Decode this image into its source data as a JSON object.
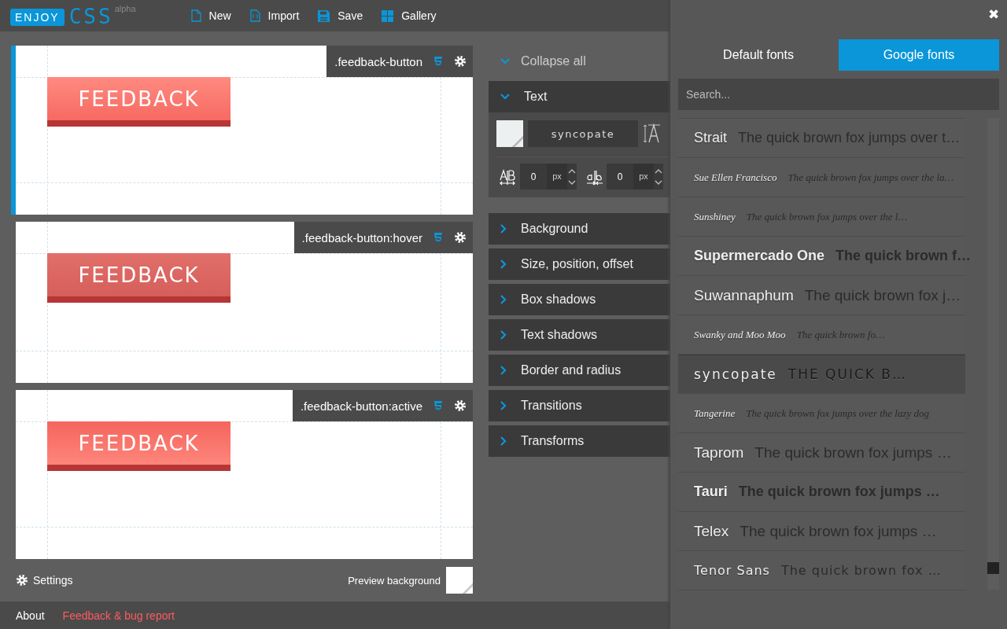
{
  "logo": {
    "word": "ENJOY",
    "name": "CSS",
    "tag": "alpha"
  },
  "toolbar": [
    {
      "label": "New",
      "kind": "file"
    },
    {
      "label": "Import",
      "kind": "import"
    },
    {
      "label": "Save",
      "kind": "save"
    },
    {
      "label": "Gallery",
      "kind": "gallery"
    }
  ],
  "previews": [
    {
      "selector": ".feedback-button",
      "selected": true,
      "kind": "normal",
      "button_text": "FEEDBACK"
    },
    {
      "selector": ".feedback-button:hover",
      "selected": false,
      "kind": "hover",
      "button_text": "FEEDBACK"
    },
    {
      "selector": ".feedback-button:active",
      "selected": false,
      "kind": "active",
      "button_text": "FEEDBACK"
    }
  ],
  "settings": {
    "label": "Settings"
  },
  "preview_background": {
    "label": "Preview background"
  },
  "properties": {
    "collapse_all": "Collapse all",
    "text_controls": {
      "font": "syncopate",
      "letter_spacing": {
        "value": "0",
        "unit": "px"
      },
      "word_spacing": {
        "value": "0",
        "unit": "px"
      }
    },
    "sections": [
      {
        "title": "Text",
        "expanded": true
      },
      {
        "title": "Background",
        "expanded": false
      },
      {
        "title": "Size, position, offset",
        "expanded": false
      },
      {
        "title": "Box shadows",
        "expanded": false
      },
      {
        "title": "Text shadows",
        "expanded": false
      },
      {
        "title": "Border and radius",
        "expanded": false
      },
      {
        "title": "Transitions",
        "expanded": false
      },
      {
        "title": "Transforms",
        "expanded": false
      }
    ]
  },
  "font_panel": {
    "close": "✖",
    "tabs": [
      {
        "label": "Default fonts",
        "selected": false
      },
      {
        "label": "Google fonts",
        "selected": true
      }
    ],
    "search": {
      "placeholder": "Search..."
    },
    "fonts": [
      {
        "name": "Strait",
        "sample": "The quick brown fox jumps over t…",
        "selected": false
      },
      {
        "name": "Sue Ellen Francisco",
        "sample": "The quick brown fox jumps over the la…",
        "selected": false
      },
      {
        "name": "Sunshiney",
        "sample": "The quick brown fox jumps over the l…",
        "selected": false
      },
      {
        "name": "Supermercado One",
        "sample": "The quick brown f…",
        "selected": false
      },
      {
        "name": "Suwannaphum",
        "sample": "The quick brown fox j…",
        "selected": false
      },
      {
        "name": "Swanky and Moo Moo",
        "sample": "The quick brown fo…",
        "selected": false
      },
      {
        "name": "syncopate",
        "sample": "THE QUICK B…",
        "selected": true
      },
      {
        "name": "Tangerine",
        "sample": "The quick brown fox jumps over the lazy dog",
        "selected": false
      },
      {
        "name": "Taprom",
        "sample": "The quick brown fox jumps …",
        "selected": false
      },
      {
        "name": "Tauri",
        "sample": "The quick brown fox jumps …",
        "selected": false
      },
      {
        "name": "Telex",
        "sample": "The quick brown fox jumps …",
        "selected": false
      },
      {
        "name": "Tenor Sans",
        "sample": "The quick brown fox …",
        "selected": false
      }
    ]
  },
  "footer": {
    "links": [
      {
        "label": "About",
        "kind": "plain"
      },
      {
        "label": "Feedback & bug report",
        "kind": "accent"
      }
    ]
  }
}
